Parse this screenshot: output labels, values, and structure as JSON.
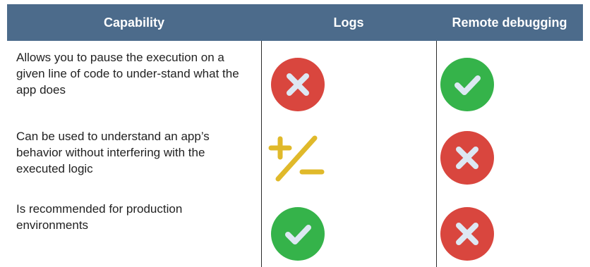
{
  "table": {
    "headers": {
      "capability": "Capability",
      "logs": "Logs",
      "remote": "Remote debugging"
    },
    "rows": [
      {
        "capability": "Allows you to pause the execution on a given line of code to under-stand what the app does",
        "logs_icon": "x-icon",
        "remote_icon": "check-icon"
      },
      {
        "capability": "Can be used to understand an app’s behavior without interfering with the executed logic",
        "logs_icon": "plus-minus-icon",
        "remote_icon": "x-icon"
      },
      {
        "capability": "Is recommended for production environments",
        "logs_icon": "check-icon",
        "remote_icon": "x-icon"
      }
    ]
  },
  "colors": {
    "header_bg": "#4c6b8b",
    "no_red": "#d9463e",
    "yes_green": "#35b34a",
    "partial_yellow": "#e0b92a",
    "icon_mark": "#dde8f3"
  }
}
